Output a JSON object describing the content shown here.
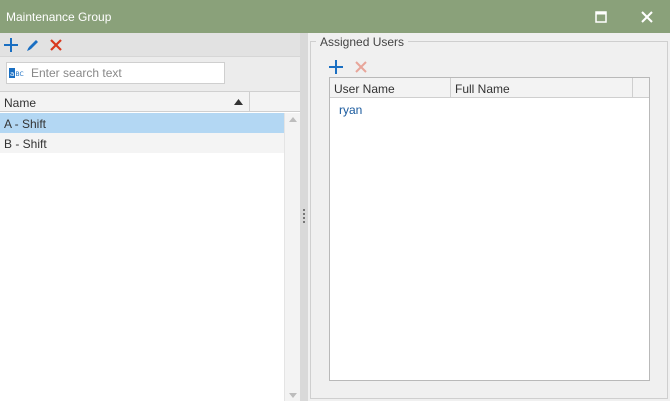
{
  "window": {
    "title": "Maintenance Group",
    "title_bar_color": "#8aa17a"
  },
  "left_toolbar": {
    "icons": [
      "add-icon",
      "edit-icon",
      "delete-icon"
    ]
  },
  "search": {
    "placeholder": "Enter search text"
  },
  "groups_grid": {
    "column_header": "Name",
    "sort": "ascending",
    "rows": [
      {
        "label": "A - Shift",
        "selected": true
      },
      {
        "label": "B - Shift",
        "selected": false
      }
    ]
  },
  "assigned_users": {
    "label": "Assigned Users",
    "toolbar_icons": [
      "add-user-icon",
      "remove-user-icon"
    ],
    "columns": [
      "User Name",
      "Full Name"
    ],
    "rows": [
      {
        "user_name": "ryan",
        "full_name": ""
      }
    ]
  },
  "colors": {
    "selection": "#b3d7f3",
    "accent_blue": "#1a6fc2",
    "delete_red": "#d9381e"
  }
}
